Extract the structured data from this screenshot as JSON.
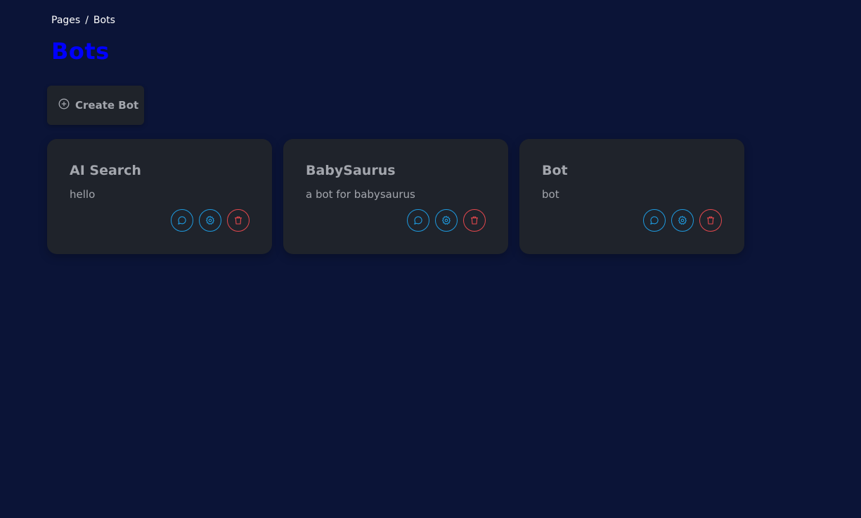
{
  "breadcrumb": {
    "items": [
      "Pages",
      "Bots"
    ],
    "separator": "/"
  },
  "page_title": "Bots",
  "create_button": {
    "label": "Create Bot",
    "icon": "plus-circle-icon"
  },
  "bots": [
    {
      "name": "AI Search",
      "description": "hello"
    },
    {
      "name": "BabySaurus",
      "description": "a bot for babysaurus"
    },
    {
      "name": "Bot",
      "description": "bot"
    }
  ],
  "card_actions": [
    {
      "icon": "chat-icon",
      "color": "#1e9be0"
    },
    {
      "icon": "gear-icon",
      "color": "#1e9be0"
    },
    {
      "icon": "trash-icon",
      "color": "#e5484d"
    }
  ],
  "colors": {
    "background": "#0b1437",
    "card": "#1f232b",
    "title": "#0000ff",
    "accent_blue": "#1e9be0",
    "accent_red": "#e5484d"
  }
}
